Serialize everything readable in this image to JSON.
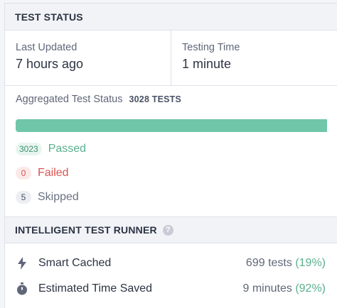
{
  "test_status": {
    "header": "TEST STATUS",
    "last_updated": {
      "label": "Last Updated",
      "value": "7 hours ago"
    },
    "testing_time": {
      "label": "Testing Time",
      "value": "1 minute"
    },
    "aggregated": {
      "label": "Aggregated Test Status",
      "count": "3028 TESTS",
      "passed_fraction": 1.0
    },
    "results": [
      {
        "count": "3023",
        "label": "Passed"
      },
      {
        "count": "0",
        "label": "Failed"
      },
      {
        "count": "5",
        "label": "Skipped"
      }
    ]
  },
  "runner": {
    "header": "INTELLIGENT TEST RUNNER",
    "help_icon": "help-circle-icon",
    "items": [
      {
        "icon": "lightning-icon",
        "label": "Smart Cached",
        "value": "699 tests",
        "pct": "(19%)"
      },
      {
        "icon": "stopwatch-icon",
        "label": "Estimated Time Saved",
        "value": "9 minutes",
        "pct": "(92%)"
      }
    ]
  },
  "colors": {
    "passed": "#6fc6a8",
    "failed": "#d9534f",
    "skipped": "#6a7282"
  }
}
